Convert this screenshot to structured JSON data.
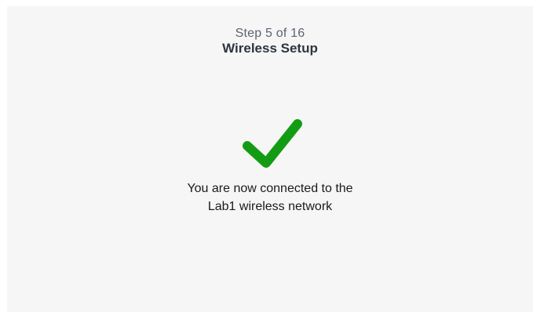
{
  "header": {
    "step": "Step 5 of 16",
    "title": "Wireless Setup"
  },
  "status": {
    "icon": "checkmark-icon",
    "color": "#139c13",
    "message_line1": "You are now connected to the",
    "message_line2": "Lab1 wireless network"
  }
}
